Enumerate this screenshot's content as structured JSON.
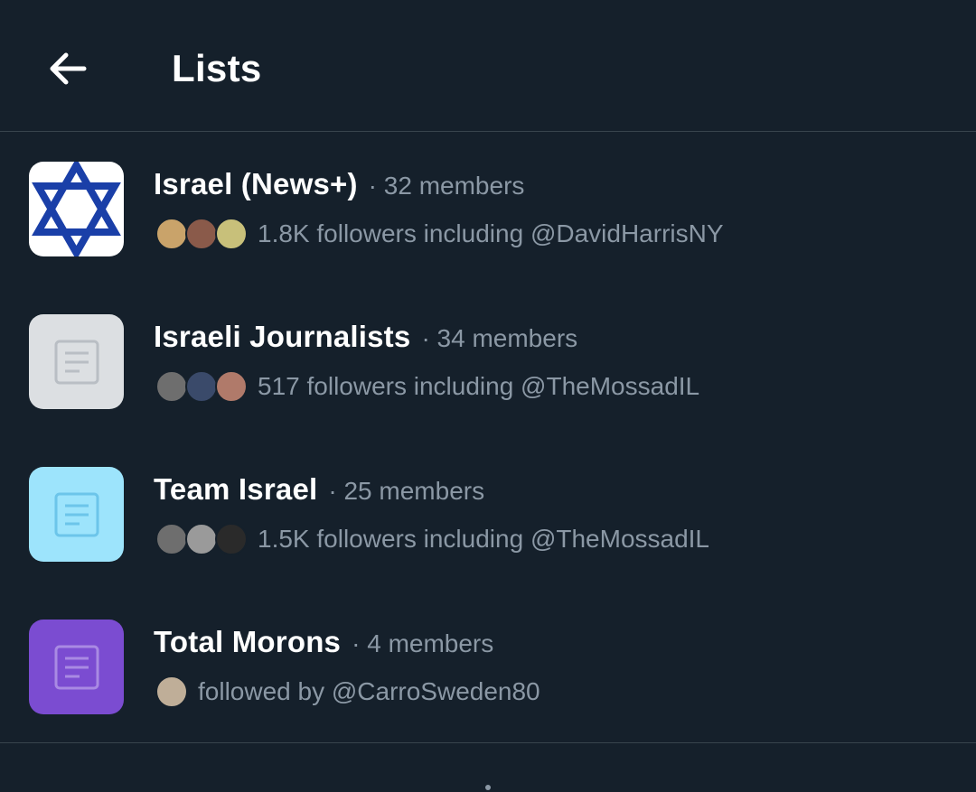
{
  "header": {
    "back_icon": "arrow-left-icon",
    "title": "Lists"
  },
  "lists": [
    {
      "name": "Israel (News+)",
      "members": "· 32 members",
      "followers": "1.8K followers including @DavidHarrisNY",
      "thumb": "star-of-david-icon",
      "thumb_bg": "#ffffff",
      "avatar_colors": [
        "#c9a36a",
        "#8a5a4a",
        "#c8c07a"
      ]
    },
    {
      "name": "Israeli Journalists",
      "members": "· 34 members",
      "followers": "517 followers including @TheMossadIL",
      "thumb": "list-document-icon",
      "thumb_bg": "#dcdfe2",
      "avatar_colors": [
        "#6e6e6e",
        "#3a4a6a",
        "#b07a6a"
      ]
    },
    {
      "name": "Team Israel",
      "members": "· 25 members",
      "followers": "1.5K followers including @TheMossadIL",
      "thumb": "list-document-icon",
      "thumb_bg": "#9de4fc",
      "avatar_colors": [
        "#6e6e6e",
        "#9a9a9a",
        "#2a2a2a"
      ]
    },
    {
      "name": "Total Morons",
      "members": "· 4 members",
      "followers": "followed by @CarroSweden80",
      "thumb": "list-document-icon",
      "thumb_bg": "#7b4cd1",
      "avatar_colors": [
        "#bfae98"
      ]
    }
  ],
  "colors": {
    "background": "#15202b",
    "secondary_text": "#8b98a5",
    "divider": "#38444d",
    "star_blue": "#1a3fa8"
  }
}
